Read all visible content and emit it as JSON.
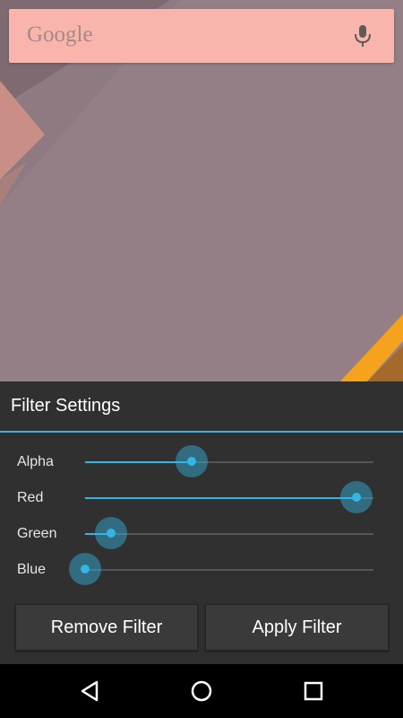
{
  "search": {
    "logo": "Google",
    "mic_icon": "microphone-icon"
  },
  "dialog": {
    "title": "Filter Settings",
    "sliders": [
      {
        "label": "Alpha",
        "value": 0.37
      },
      {
        "label": "Red",
        "value": 0.94
      },
      {
        "label": "Green",
        "value": 0.09
      },
      {
        "label": "Blue",
        "value": 0.0
      }
    ],
    "remove_label": "Remove Filter",
    "apply_label": "Apply Filter",
    "accent": "#33b5e5"
  },
  "nav": {
    "back_icon": "back-icon",
    "home_icon": "home-icon",
    "recents_icon": "recents-icon"
  }
}
